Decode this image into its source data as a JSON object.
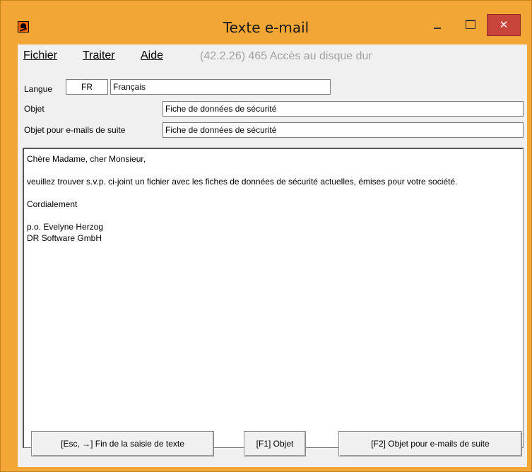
{
  "window": {
    "title": "Texte e-mail",
    "icon": "hazard-skull-icon",
    "accent": "#f2a636",
    "close_color": "#c7453a"
  },
  "menu": {
    "items": [
      {
        "label": "Fichier"
      },
      {
        "label": "Traiter"
      },
      {
        "label": "Aide"
      }
    ],
    "status": "(42.2.26) 465 Accès au disque dur"
  },
  "form": {
    "language_label": "Langue",
    "language_code": "FR",
    "language_name": "Français",
    "subject_label": "Objet",
    "subject_value": "Fiche de données de sécurité",
    "followup_label": "Objet pour e-mails de suite",
    "followup_value": "Fiche de données de sécurité"
  },
  "body": {
    "greeting": "Chère Madame, cher Monsieur,",
    "paragraph": "veuillez trouver s.v.p. ci-joint un fichier avec les fiches de données de sécurité actuelles, émises pour votre société.",
    "closing": "Cordialement",
    "signature_line1": "p.o. Evelyne Herzog",
    "signature_line2": "DR Software GmbH"
  },
  "buttons": {
    "end_input": "[Esc, →] Fin de la saisie de texte",
    "subject": "[F1] Objet",
    "followup_subject": "[F2] Objet pour e-mails de suite"
  }
}
